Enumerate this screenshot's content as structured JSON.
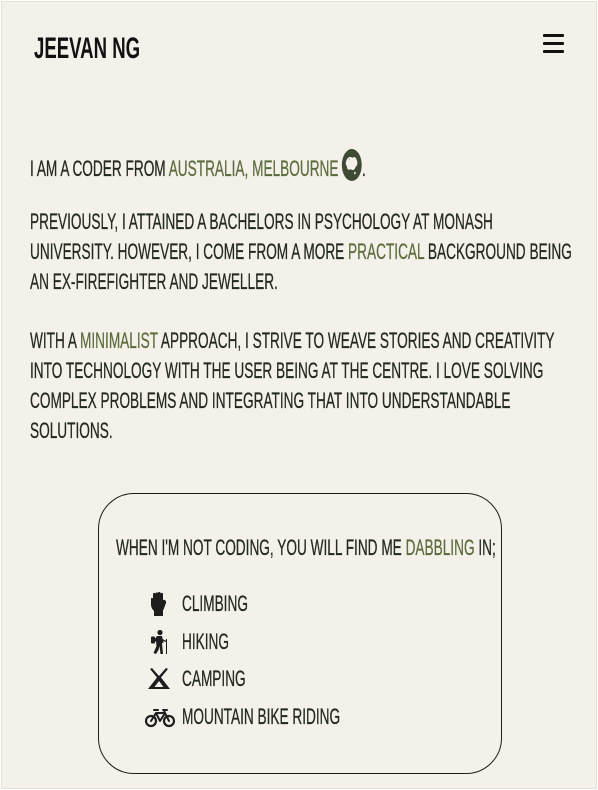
{
  "header": {
    "brand": "JEEVAN NG",
    "menu_icon": "hamburger-menu-icon"
  },
  "intro": {
    "p1": {
      "before": "I am a coder from ",
      "highlight": "Australia, Melbourne",
      "icon": "globe-australia-icon",
      "after": "."
    },
    "p2": {
      "before": "Previously, I attained a bachelors in psychology at Monash University. However, I come from a more ",
      "highlight": "practical",
      "after": " background being an ex-firefighter and jeweller."
    },
    "p3": {
      "before": "With a ",
      "highlight": "minimalist",
      "after": " approach, I strive to weave stories and creativity into technology with the user being at the centre. I love solving complex problems and integrating that into understandable solutions."
    }
  },
  "hobbies": {
    "intro_before": "When I'm not coding, you will find me ",
    "intro_highlight": "dabbling",
    "intro_after": " in;",
    "items": [
      {
        "label": "Climbing",
        "icon": "fist-icon"
      },
      {
        "label": "Hiking",
        "icon": "hiker-icon"
      },
      {
        "label": "Camping",
        "icon": "tent-icon"
      },
      {
        "label": "Mountain bike riding",
        "icon": "bicycle-icon"
      }
    ]
  },
  "colors": {
    "background": "#f4f1ea",
    "text": "#242a1f",
    "accent": "#5d6d3e"
  }
}
